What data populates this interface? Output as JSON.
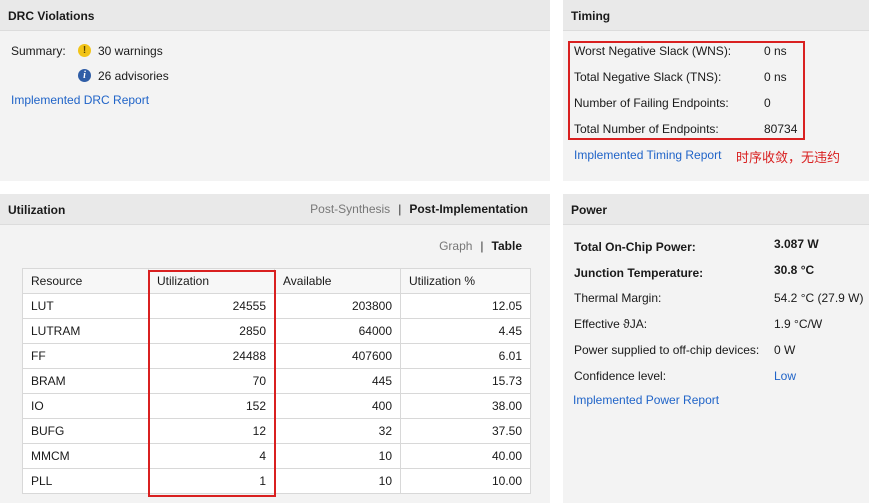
{
  "drc": {
    "title": "DRC Violations",
    "summary_label": "Summary:",
    "warnings": "30 warnings",
    "advisories": "26 advisories",
    "report_link": "Implemented DRC Report",
    "warn_glyph": "!",
    "info_glyph": "i"
  },
  "timing": {
    "title": "Timing",
    "rows": [
      {
        "label": "Worst Negative Slack (WNS):",
        "value": "0 ns"
      },
      {
        "label": "Total Negative Slack (TNS):",
        "value": "0 ns"
      },
      {
        "label": "Number of Failing Endpoints:",
        "value": "0"
      },
      {
        "label": "Total Number of Endpoints:",
        "value": "80734"
      }
    ],
    "report_link": "Implemented Timing Report",
    "annotation": "时序收敛，无违约",
    "annotation_color": "#d92020"
  },
  "utilization": {
    "title": "Utilization",
    "tabs": [
      "Post-Synthesis",
      "Post-Implementation"
    ],
    "active_tab": "Post-Implementation",
    "views": [
      "Graph",
      "Table"
    ],
    "active_view": "Table",
    "separator": "|",
    "columns": [
      "Resource",
      "Utilization",
      "Available",
      "Utilization %"
    ],
    "rows": [
      [
        "LUT",
        "24555",
        "203800",
        "12.05"
      ],
      [
        "LUTRAM",
        "2850",
        "64000",
        "4.45"
      ],
      [
        "FF",
        "24488",
        "407600",
        "6.01"
      ],
      [
        "BRAM",
        "70",
        "445",
        "15.73"
      ],
      [
        "IO",
        "152",
        "400",
        "38.00"
      ],
      [
        "BUFG",
        "12",
        "32",
        "37.50"
      ],
      [
        "MMCM",
        "4",
        "10",
        "40.00"
      ],
      [
        "PLL",
        "1",
        "10",
        "10.00"
      ]
    ]
  },
  "power": {
    "title": "Power",
    "rows": [
      {
        "label": "Total On-Chip Power:",
        "value": "3.087 W",
        "bold": true
      },
      {
        "label": "Junction Temperature:",
        "value": "30.8 °C",
        "bold": true
      },
      {
        "label": "Thermal Margin:",
        "value": "54.2 °C (27.9 W)",
        "bold": false
      },
      {
        "label": "Effective ϑJA:",
        "value": "1.9 °C/W",
        "bold": false
      },
      {
        "label": "Power supplied to off-chip devices:",
        "value": "0 W",
        "bold": false
      },
      {
        "label": "Confidence level:",
        "value": "Low",
        "bold": false,
        "link": true
      }
    ],
    "report_link": "Implemented Power Report"
  },
  "colors": {
    "link": "#2064c8",
    "highlight_box": "#d92020",
    "panel_bg": "#f3f3f3",
    "header_bg": "#e9e9e9"
  }
}
